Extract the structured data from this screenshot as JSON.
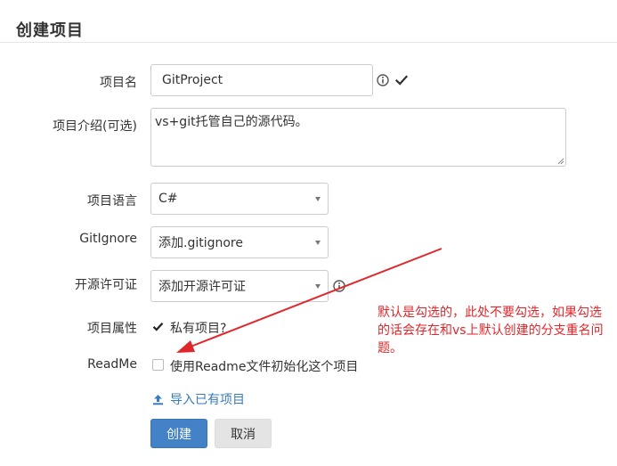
{
  "page": {
    "title": "创建项目"
  },
  "form": {
    "name": {
      "label": "项目名",
      "value": "GitProject"
    },
    "description": {
      "label": "项目介绍(可选)",
      "value": "vs+git托管自己的源代码。"
    },
    "language": {
      "label": "项目语言",
      "selected": "C#"
    },
    "gitignore": {
      "label": "GitIgnore",
      "selected": "添加.gitignore"
    },
    "license": {
      "label": "开源许可证",
      "selected": "添加开源许可证"
    },
    "attributes": {
      "label": "项目属性",
      "private_label": "私有项目?",
      "private_checked": true
    },
    "readme": {
      "label": "ReadMe",
      "init_label": "使用Readme文件初始化这个项目",
      "init_checked": false
    }
  },
  "actions": {
    "import_label": "导入已有项目",
    "create_label": "创建",
    "cancel_label": "取消"
  },
  "annotation": {
    "text": "默认是勾选的，此处不要勾选，如果勾选的话会存在和vs上默认创建的分支重名问题。",
    "color": "#e0262a"
  },
  "colors": {
    "primary": "#4382c6",
    "link": "#3a7ac0",
    "annotation": "#e0262a"
  }
}
